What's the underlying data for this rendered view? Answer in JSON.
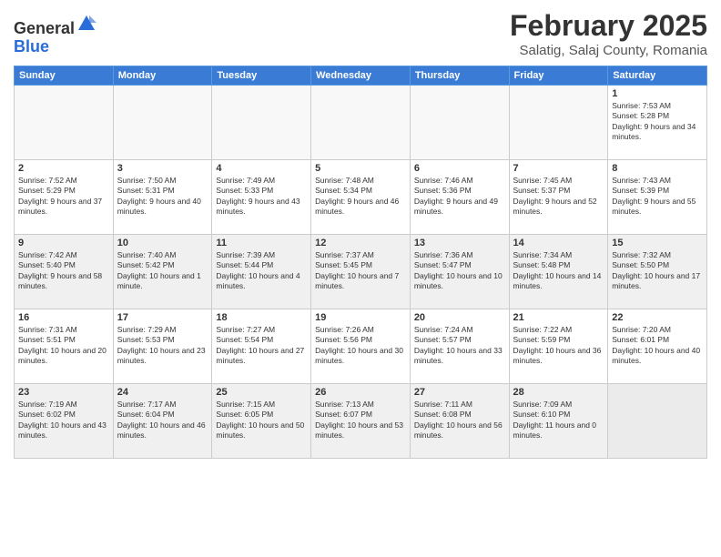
{
  "header": {
    "logo_general": "General",
    "logo_blue": "Blue",
    "month_title": "February 2025",
    "location": "Salatig, Salaj County, Romania"
  },
  "weekdays": [
    "Sunday",
    "Monday",
    "Tuesday",
    "Wednesday",
    "Thursday",
    "Friday",
    "Saturday"
  ],
  "weeks": [
    {
      "shaded": false,
      "days": [
        {
          "date": "",
          "info": ""
        },
        {
          "date": "",
          "info": ""
        },
        {
          "date": "",
          "info": ""
        },
        {
          "date": "",
          "info": ""
        },
        {
          "date": "",
          "info": ""
        },
        {
          "date": "",
          "info": ""
        },
        {
          "date": "1",
          "info": "Sunrise: 7:53 AM\nSunset: 5:28 PM\nDaylight: 9 hours and 34 minutes."
        }
      ]
    },
    {
      "shaded": false,
      "days": [
        {
          "date": "2",
          "info": "Sunrise: 7:52 AM\nSunset: 5:29 PM\nDaylight: 9 hours and 37 minutes."
        },
        {
          "date": "3",
          "info": "Sunrise: 7:50 AM\nSunset: 5:31 PM\nDaylight: 9 hours and 40 minutes."
        },
        {
          "date": "4",
          "info": "Sunrise: 7:49 AM\nSunset: 5:33 PM\nDaylight: 9 hours and 43 minutes."
        },
        {
          "date": "5",
          "info": "Sunrise: 7:48 AM\nSunset: 5:34 PM\nDaylight: 9 hours and 46 minutes."
        },
        {
          "date": "6",
          "info": "Sunrise: 7:46 AM\nSunset: 5:36 PM\nDaylight: 9 hours and 49 minutes."
        },
        {
          "date": "7",
          "info": "Sunrise: 7:45 AM\nSunset: 5:37 PM\nDaylight: 9 hours and 52 minutes."
        },
        {
          "date": "8",
          "info": "Sunrise: 7:43 AM\nSunset: 5:39 PM\nDaylight: 9 hours and 55 minutes."
        }
      ]
    },
    {
      "shaded": true,
      "days": [
        {
          "date": "9",
          "info": "Sunrise: 7:42 AM\nSunset: 5:40 PM\nDaylight: 9 hours and 58 minutes."
        },
        {
          "date": "10",
          "info": "Sunrise: 7:40 AM\nSunset: 5:42 PM\nDaylight: 10 hours and 1 minute."
        },
        {
          "date": "11",
          "info": "Sunrise: 7:39 AM\nSunset: 5:44 PM\nDaylight: 10 hours and 4 minutes."
        },
        {
          "date": "12",
          "info": "Sunrise: 7:37 AM\nSunset: 5:45 PM\nDaylight: 10 hours and 7 minutes."
        },
        {
          "date": "13",
          "info": "Sunrise: 7:36 AM\nSunset: 5:47 PM\nDaylight: 10 hours and 10 minutes."
        },
        {
          "date": "14",
          "info": "Sunrise: 7:34 AM\nSunset: 5:48 PM\nDaylight: 10 hours and 14 minutes."
        },
        {
          "date": "15",
          "info": "Sunrise: 7:32 AM\nSunset: 5:50 PM\nDaylight: 10 hours and 17 minutes."
        }
      ]
    },
    {
      "shaded": false,
      "days": [
        {
          "date": "16",
          "info": "Sunrise: 7:31 AM\nSunset: 5:51 PM\nDaylight: 10 hours and 20 minutes."
        },
        {
          "date": "17",
          "info": "Sunrise: 7:29 AM\nSunset: 5:53 PM\nDaylight: 10 hours and 23 minutes."
        },
        {
          "date": "18",
          "info": "Sunrise: 7:27 AM\nSunset: 5:54 PM\nDaylight: 10 hours and 27 minutes."
        },
        {
          "date": "19",
          "info": "Sunrise: 7:26 AM\nSunset: 5:56 PM\nDaylight: 10 hours and 30 minutes."
        },
        {
          "date": "20",
          "info": "Sunrise: 7:24 AM\nSunset: 5:57 PM\nDaylight: 10 hours and 33 minutes."
        },
        {
          "date": "21",
          "info": "Sunrise: 7:22 AM\nSunset: 5:59 PM\nDaylight: 10 hours and 36 minutes."
        },
        {
          "date": "22",
          "info": "Sunrise: 7:20 AM\nSunset: 6:01 PM\nDaylight: 10 hours and 40 minutes."
        }
      ]
    },
    {
      "shaded": true,
      "days": [
        {
          "date": "23",
          "info": "Sunrise: 7:19 AM\nSunset: 6:02 PM\nDaylight: 10 hours and 43 minutes."
        },
        {
          "date": "24",
          "info": "Sunrise: 7:17 AM\nSunset: 6:04 PM\nDaylight: 10 hours and 46 minutes."
        },
        {
          "date": "25",
          "info": "Sunrise: 7:15 AM\nSunset: 6:05 PM\nDaylight: 10 hours and 50 minutes."
        },
        {
          "date": "26",
          "info": "Sunrise: 7:13 AM\nSunset: 6:07 PM\nDaylight: 10 hours and 53 minutes."
        },
        {
          "date": "27",
          "info": "Sunrise: 7:11 AM\nSunset: 6:08 PM\nDaylight: 10 hours and 56 minutes."
        },
        {
          "date": "28",
          "info": "Sunrise: 7:09 AM\nSunset: 6:10 PM\nDaylight: 11 hours and 0 minutes."
        },
        {
          "date": "",
          "info": ""
        }
      ]
    }
  ]
}
